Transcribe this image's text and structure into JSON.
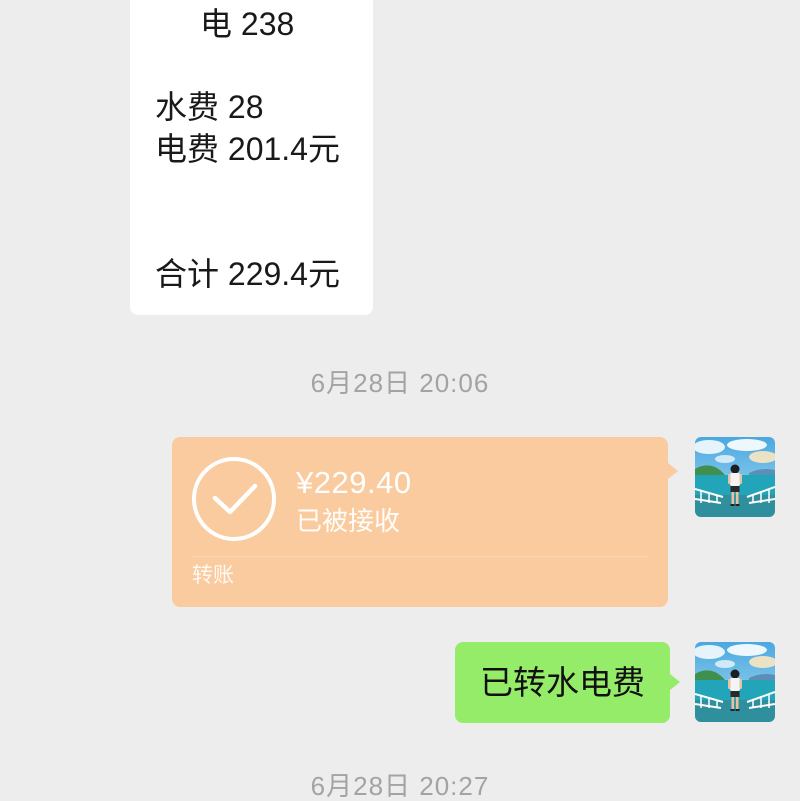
{
  "theme": {
    "background": "#ededed",
    "incoming_bubble": "#ffffff",
    "outgoing_bubble": "#95ec69",
    "transfer_bubble": "#f9cb9f",
    "timestamp_text": "#a3a3a3"
  },
  "icons": {
    "transfer": "check-circle-icon",
    "avatar": "avatar-photo"
  },
  "incoming_message": {
    "lines": [
      "电 238",
      "",
      "水费 28",
      "电费 201.4元",
      "",
      "",
      "合计 229.4元"
    ]
  },
  "timestamp_1": "6月28日 20:06",
  "transfer_message": {
    "amount": "¥229.40",
    "status": "已被接收",
    "label": "转账"
  },
  "outgoing_message": {
    "text": "已转水电费"
  },
  "timestamp_2": "6月28日 20:27"
}
